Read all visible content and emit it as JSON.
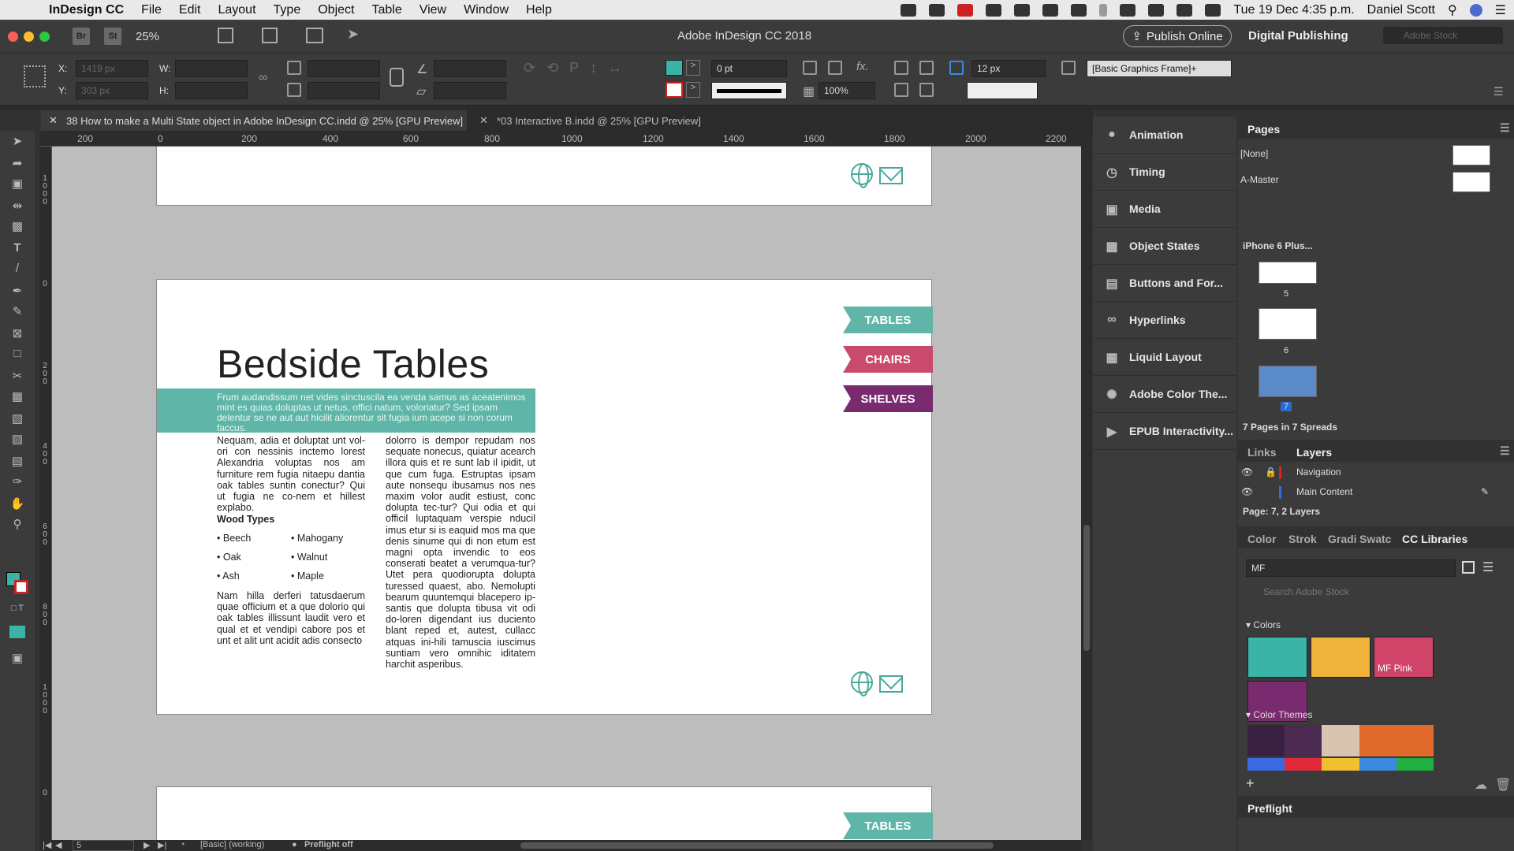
{
  "menubar": {
    "app": "InDesign CC",
    "items": [
      "File",
      "Edit",
      "Layout",
      "Type",
      "Object",
      "Table",
      "View",
      "Window",
      "Help"
    ],
    "datetime": "Tue 19 Dec  4:35 p.m.",
    "user": "Daniel Scott"
  },
  "appbar": {
    "br": "Br",
    "st": "St",
    "zoom": "25%",
    "title": "Adobe InDesign CC 2018",
    "publish": "Publish Online",
    "workspace": "Digital Publishing",
    "stock_placeholder": "Adobe Stock"
  },
  "control": {
    "x_label": "X:",
    "y_label": "Y:",
    "w_label": "W:",
    "h_label": "H:",
    "x_value": "1419 px",
    "y_value": "303 px",
    "stroke": "0 pt",
    "scale": "100%",
    "size": "12 px",
    "style": "[Basic Graphics Frame]+"
  },
  "tabs": [
    {
      "label": "38 How to make a Multi State object in Adobe InDesign CC.indd @ 25% [GPU Preview]"
    },
    {
      "label": "*03 Interactive B.indd @ 25% [GPU Preview]"
    }
  ],
  "ruler": {
    "h": [
      "200",
      "0",
      "200",
      "400",
      "600",
      "800",
      "1000",
      "1200",
      "1400",
      "1600",
      "1800",
      "2000",
      "2200"
    ],
    "v": [
      "1\n0\n0\n0",
      "0",
      "2\n0\n0",
      "4\n0\n0",
      "6\n0\n0",
      "8\n0\n0",
      "1\n0\n0\n0",
      "0"
    ]
  },
  "page": {
    "nav": [
      "TABLES",
      "CHAIRS",
      "SHELVES"
    ],
    "nav_bottom": "TABLES",
    "headline": "Bedside Tables",
    "intro": "Frum audandissum net vides sinctuscila ea venda samus as aceatenimos mint es quias doluptas ut netus, offici natum, voloriatur? Sed ipsam delentur se ne aut aut hicilit aliorentur sit fugia ium acepe si non corum faccus.",
    "col1_top": "Nequam, adia et doluptat unt vol-ori con nessinis inctemo lorest Alexandria voluptas nos am furniture rem fugia nitaepu dantia oak tables suntin conectur? Qui ut fugia ne co-nem et hillest explabo.",
    "wood_title": "Wood Types",
    "wood": [
      "Beech",
      "Mahogany",
      "Oak",
      "Walnut",
      "Ash",
      "Maple"
    ],
    "col1_bottom": "Nam hilla derferi tatusdaerum quae officium et a que dolorio qui oak tables illissunt laudit vero et qual et et vendipi cabore pos et unt et alit unt acidit adis consecto",
    "col2": "dolorro is dempor repudam nos sequate nonecus, quiatur acearch illora quis et re sunt lab il ipidit, ut que cum fuga. Estruptas ipsam aute nonsequ ibusamus nos nes maxim volor audit estiust, conc dolupta tec-tur? Qui odia et qui officil luptaquam verspie nducil imus etur si is eaquid mos ma que denis sinume qui di non etum est magni opta invendic to eos conserati beatet a verumqua-tur? Utet pera quodiorupta dolupta turessed quaest, abo. Nemolupti bearum quuntemqui blacepero ip-santis que dolupta tibusa vit odi do-loren digendant ius duciento blant reped et, autest, cullacc atquas ini-hili tamuscia iuscimus suntiam vero omnihic iditatem harchit asperibus."
  },
  "status": {
    "page": "5",
    "profile": "[Basic] (working)",
    "preflight": "Preflight off"
  },
  "midpanel": [
    "Animation",
    "Timing",
    "Media",
    "Object States",
    "Buttons and For...",
    "Hyperlinks",
    "Liquid Layout",
    "Adobe Color The...",
    "EPUB Interactivity..."
  ],
  "pages_panel": {
    "title": "Pages",
    "none": "[None]",
    "master": "A-Master",
    "device": "iPhone 6 Plus...",
    "page_nums": [
      "5",
      "6",
      "7"
    ],
    "summary": "7 Pages in 7 Spreads"
  },
  "layers_panel": {
    "tabs": [
      "Links",
      "Layers"
    ],
    "layers": [
      "Navigation",
      "Main Content"
    ],
    "summary": "Page: 7, 2 Layers"
  },
  "libraries": {
    "tabs": [
      "Color",
      "Strok",
      "Gradi",
      "Swatc",
      "CC Libraries"
    ],
    "library": "MF",
    "search_placeholder": "Search Adobe Stock",
    "colors_title": "Colors",
    "swatch_label": "MF Pink",
    "themes_title": "Color Themes",
    "colors": [
      "#3bb4a8",
      "#f0b43c",
      "#d0446a",
      "#7a2a6e"
    ],
    "theme": [
      "#3a2040",
      "#4a2a50",
      "#d8c4b0",
      "#e06a2a",
      "#e06a2a"
    ],
    "theme2": [
      "#3a6ae0",
      "#e02a3a",
      "#f0c030",
      "#3a8ae0",
      "#20b040"
    ]
  },
  "preflight": "Preflight"
}
